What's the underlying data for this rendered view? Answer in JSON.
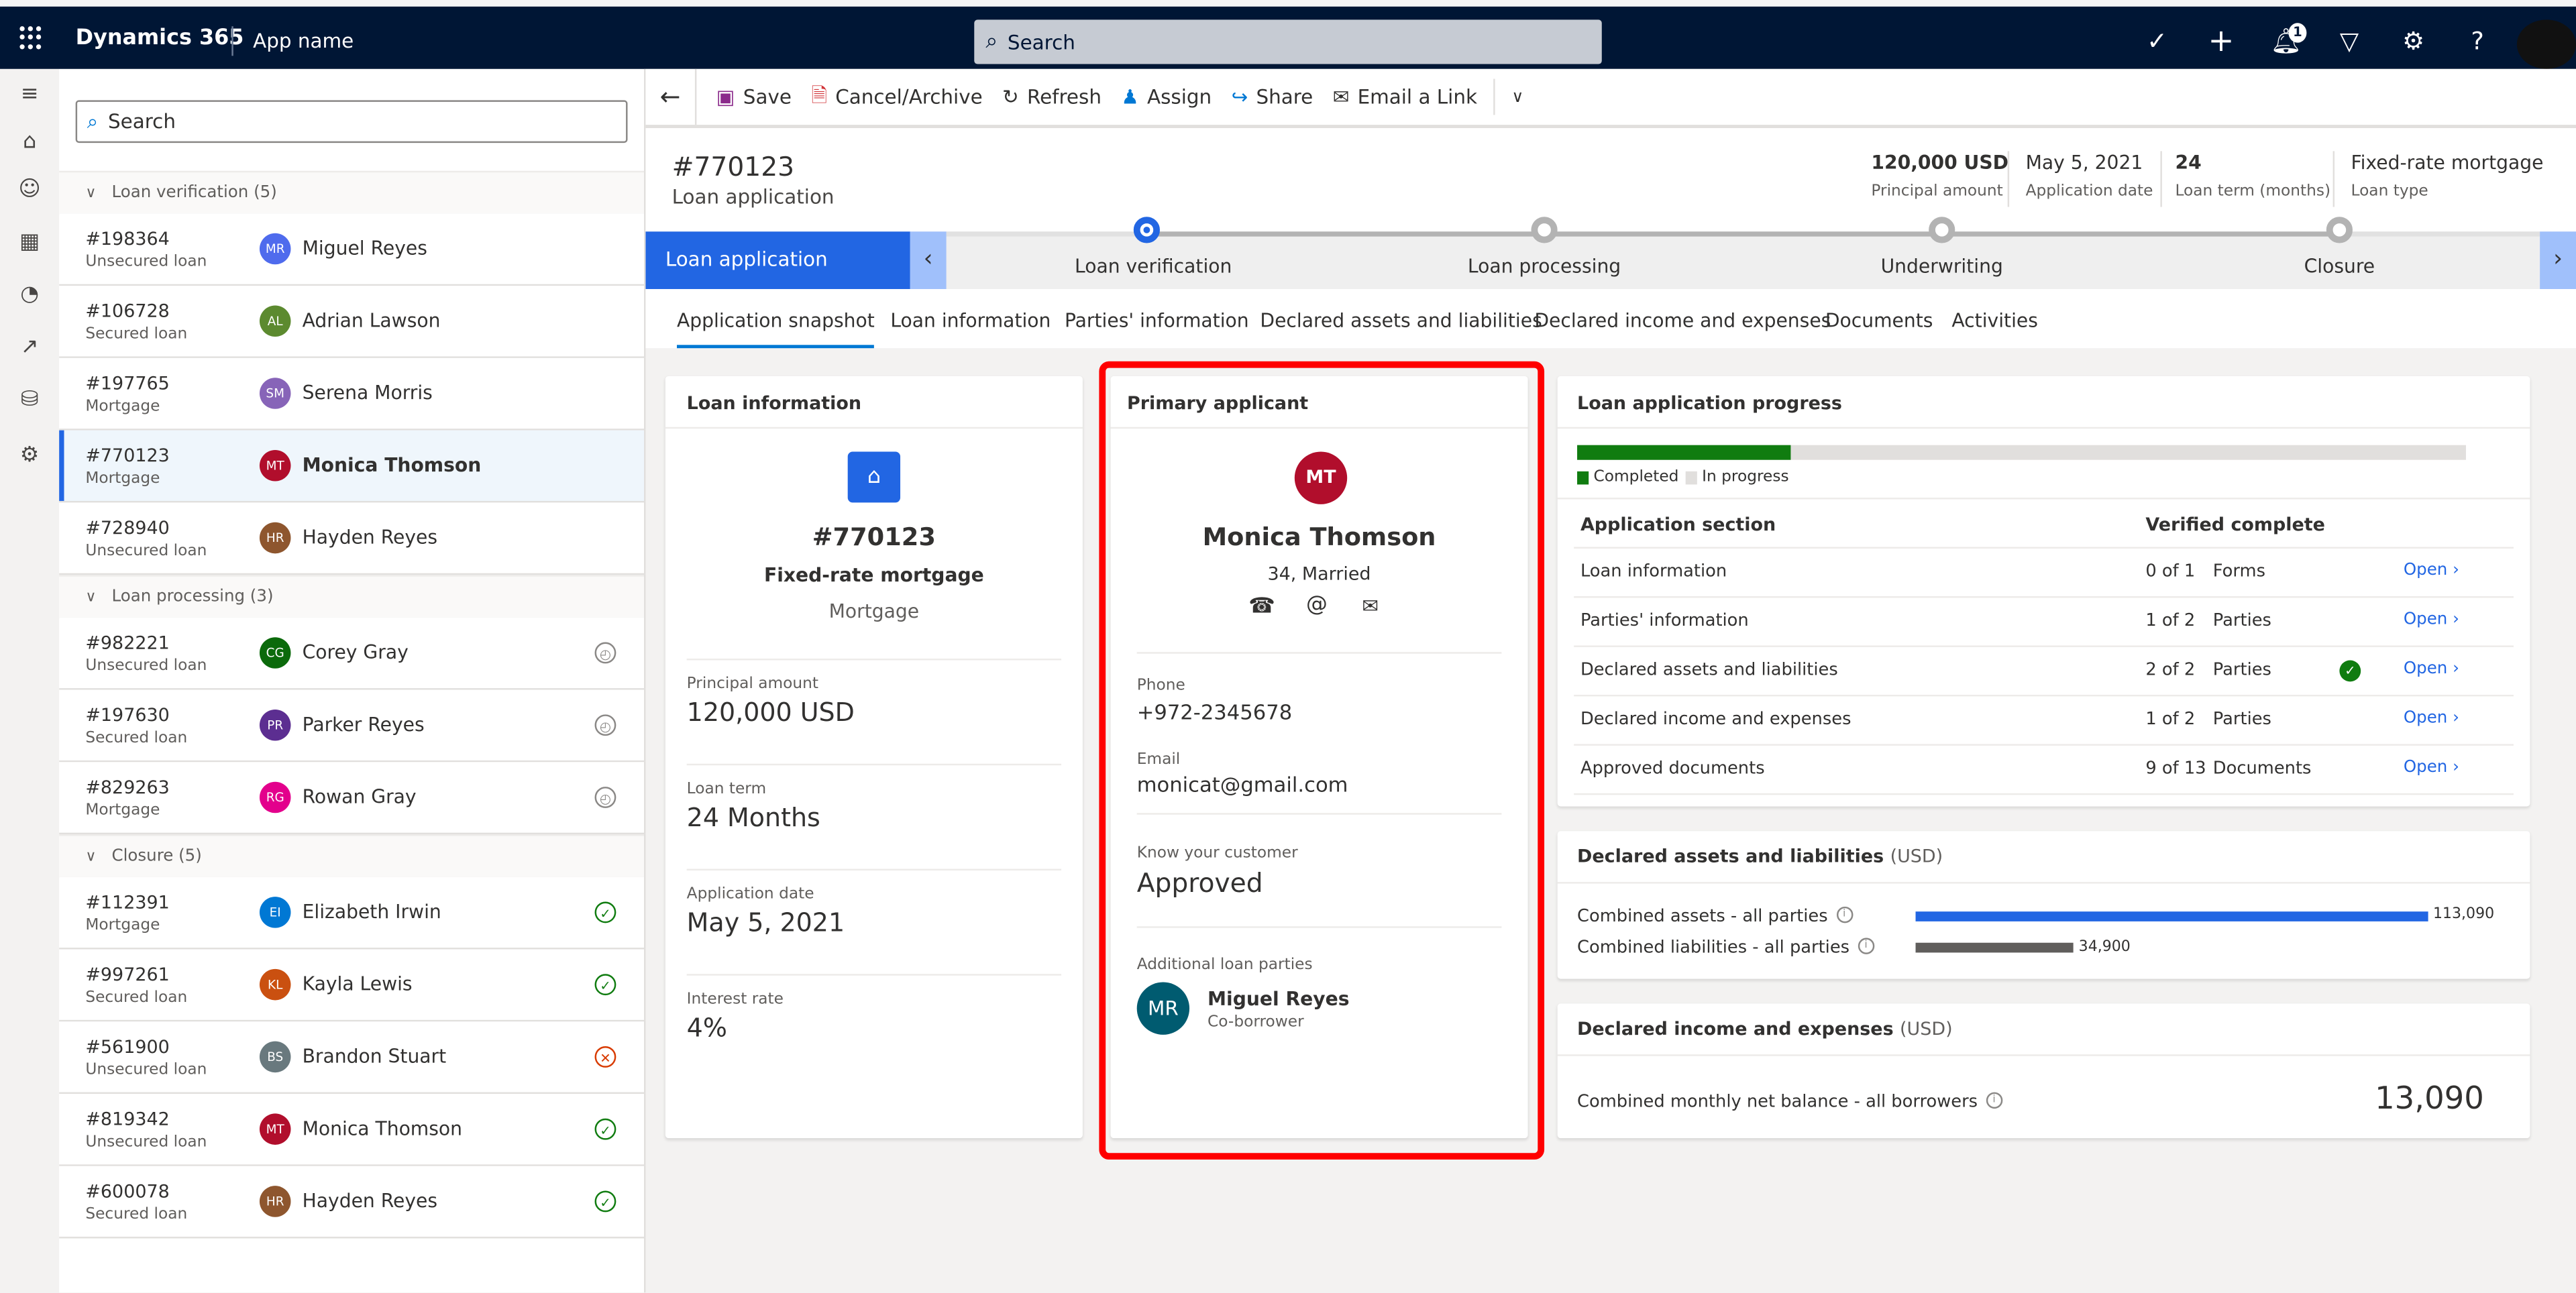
{
  "topbar": {
    "brand": "Dynamics 365",
    "app_name": "App name",
    "search_placeholder": "Search",
    "notification_count": "1",
    "icons": [
      "task-icon",
      "add-icon",
      "bell-icon",
      "filter-icon",
      "gear-icon",
      "help-icon"
    ]
  },
  "rail": {
    "icons": [
      "hamburger-icon",
      "home-icon",
      "contacts-icon",
      "calendar-people-icon",
      "pie-chart-icon",
      "line-chart-icon",
      "database-settings-icon",
      "settings-icon"
    ]
  },
  "list": {
    "search_placeholder": "Search",
    "groups": [
      {
        "label": "Loan verification (5)",
        "items": [
          {
            "id": "#198364",
            "type": "Unsecured loan",
            "initials": "MR",
            "name": "Miguel Reyes",
            "color": "#4f6bed",
            "status": ""
          },
          {
            "id": "#106728",
            "type": "Secured loan",
            "initials": "AL",
            "name": "Adrian Lawson",
            "color": "#5c8a2f",
            "status": ""
          },
          {
            "id": "#197765",
            "type": "Mortgage",
            "initials": "SM",
            "name": "Serena Morris",
            "color": "#8764b8",
            "status": ""
          },
          {
            "id": "#770123",
            "type": "Mortgage",
            "initials": "MT",
            "name": "Monica Thomson",
            "color": "#b10e2c",
            "status": "",
            "selected": true
          },
          {
            "id": "#728940",
            "type": "Unsecured loan",
            "initials": "HR",
            "name": "Hayden Reyes",
            "color": "#8e562e",
            "status": ""
          }
        ]
      },
      {
        "label": "Loan processing (3)",
        "items": [
          {
            "id": "#982221",
            "type": "Unsecured loan",
            "initials": "CG",
            "name": "Corey Gray",
            "color": "#0b6a0b",
            "status": "pending"
          },
          {
            "id": "#197630",
            "type": "Secured loan",
            "initials": "PR",
            "name": "Parker Reyes",
            "color": "#5c2e91",
            "status": "pending"
          },
          {
            "id": "#829263",
            "type": "Mortgage",
            "initials": "RG",
            "name": "Rowan Gray",
            "color": "#e3008c",
            "status": "pending"
          }
        ]
      },
      {
        "label": "Closure (5)",
        "items": [
          {
            "id": "#112391",
            "type": "Mortgage",
            "initials": "EI",
            "name": "Elizabeth Irwin",
            "color": "#0078d4",
            "status": "approved"
          },
          {
            "id": "#997261",
            "type": "Secured loan",
            "initials": "KL",
            "name": "Kayla Lewis",
            "color": "#ca5010",
            "status": "approved"
          },
          {
            "id": "#561900",
            "type": "Unsecured loan",
            "initials": "BS",
            "name": "Brandon Stuart",
            "color": "#69797e",
            "status": "rejected"
          },
          {
            "id": "#819342",
            "type": "Unsecured loan",
            "initials": "MT",
            "name": "Monica Thomson",
            "color": "#b10e2c",
            "status": "approved"
          },
          {
            "id": "#600078",
            "type": "Secured loan",
            "initials": "HR",
            "name": "Hayden Reyes",
            "color": "#8e562e",
            "status": "approved"
          }
        ]
      }
    ]
  },
  "commands": {
    "save": "Save",
    "cancel_archive": "Cancel/Archive",
    "refresh": "Refresh",
    "assign": "Assign",
    "share": "Share",
    "email_link": "Email a Link"
  },
  "record": {
    "id": "#770123",
    "type": "Loan application",
    "header_fields": [
      {
        "value": "120,000 USD",
        "label": "Principal amount"
      },
      {
        "value": "May 5, 2021",
        "label": "Application date"
      },
      {
        "value": "24",
        "label": "Loan term (months)"
      },
      {
        "value": "Fixed-rate mortgage",
        "label": "Loan type"
      }
    ]
  },
  "bpf": {
    "active_process": "Loan application",
    "stages": [
      "Loan verification",
      "Loan processing",
      "Underwriting",
      "Closure"
    ],
    "current_stage": "Loan verification"
  },
  "tabs": [
    "Application snapshot",
    "Loan information",
    "Parties' information",
    "Declared assets and liabilities",
    "Declared income and expenses",
    "Documents",
    "Activities"
  ],
  "active_tab": "Application snapshot",
  "loan_card": {
    "title": "Loan information",
    "id": "#770123",
    "product": "Fixed-rate mortgage",
    "category": "Mortgage",
    "fields": [
      {
        "label": "Principal amount",
        "value": "120,000 USD"
      },
      {
        "label": "Loan term",
        "value": "24 Months"
      },
      {
        "label": "Application date",
        "value": "May 5, 2021"
      },
      {
        "label": "Interest rate",
        "value": "4%"
      }
    ]
  },
  "applicant_card": {
    "title": "Primary applicant",
    "initials": "MT",
    "name": "Monica Thomson",
    "subtitle": "34, Married",
    "phone_label": "Phone",
    "phone": "+972-2345678",
    "email_label": "Email",
    "email": "monicat@gmail.com",
    "kyc_label": "Know your customer",
    "kyc_value": "Approved",
    "parties_label": "Additional loan parties",
    "party": {
      "initials": "MR",
      "name": "Miguel Reyes",
      "role": "Co-borrower"
    }
  },
  "progress_card": {
    "title": "Loan application progress",
    "completed_fraction": 0.24,
    "legend_completed": "Completed",
    "legend_in_progress": "In progress",
    "col_section": "Application section",
    "col_verified": "Verified complete",
    "open_label": "Open",
    "rows": [
      {
        "section": "Loan information",
        "count": "0 of 1",
        "unit": "Forms",
        "complete": false
      },
      {
        "section": "Parties' information",
        "count": "1 of 2",
        "unit": "Parties",
        "complete": false
      },
      {
        "section": "Declared assets and liabilities",
        "count": "2 of 2",
        "unit": "Parties",
        "complete": true
      },
      {
        "section": "Declared income and expenses",
        "count": "1 of 2",
        "unit": "Parties",
        "complete": false
      },
      {
        "section": "Approved documents",
        "count": "9 of 13",
        "unit": "Documents",
        "complete": false
      }
    ]
  },
  "assets_card": {
    "title": "Declared assets and liabilities",
    "unit": "(USD)",
    "assets_label": "Combined assets - all parties",
    "assets_value": 113090,
    "assets_display": "113,090",
    "liabilities_label": "Combined liabilities - all parties",
    "liabilities_value": 34900,
    "liabilities_display": "34,900"
  },
  "income_card": {
    "title": "Declared income and expenses",
    "unit": "(USD)",
    "balance_label": "Combined monthly net balance - all borrowers",
    "balance_value": "13,090"
  }
}
